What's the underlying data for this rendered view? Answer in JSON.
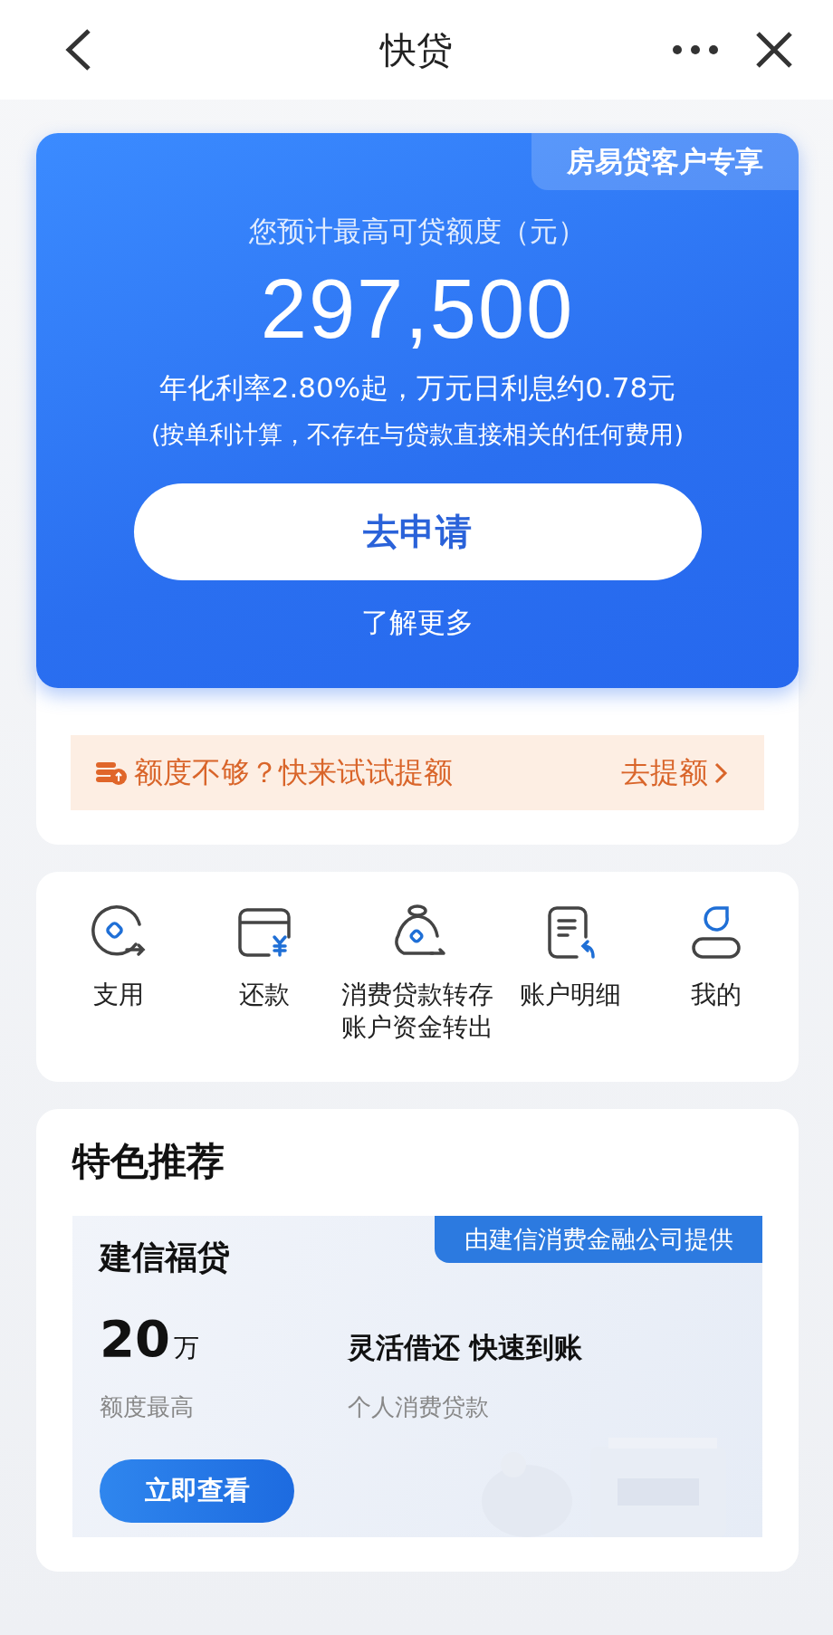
{
  "nav": {
    "title": "快贷"
  },
  "quota_card": {
    "badge": "房易贷客户专享",
    "subtitle": "您预计最高可贷额度（元）",
    "amount": "297,500",
    "rate_line": "年化利率2.80%起，万元日利息约0.78元",
    "note": "(按单利计算，不存在与贷款直接相关的任何费用)",
    "apply_button": "去申请",
    "more_link": "了解更多"
  },
  "raise_banner": {
    "text": "额度不够？快来试试提额",
    "action": "去提额"
  },
  "shortcuts": [
    {
      "kind": "withdraw",
      "label": "支用"
    },
    {
      "kind": "repay",
      "label": "还款"
    },
    {
      "kind": "transfer",
      "label": "消费贷款转存账户资金转出"
    },
    {
      "kind": "statement",
      "label": "账户明细"
    },
    {
      "kind": "profile",
      "label": "我的"
    }
  ],
  "recommend": {
    "title": "特色推荐",
    "product": {
      "name": "建信福贷",
      "provider_badge": "由建信消费金融公司提供",
      "amount": "20",
      "unit": "万",
      "amount_caption": "额度最高",
      "slogan": "灵活借还 快速到账",
      "type": "个人消费贷款",
      "button": "立即查看"
    }
  }
}
